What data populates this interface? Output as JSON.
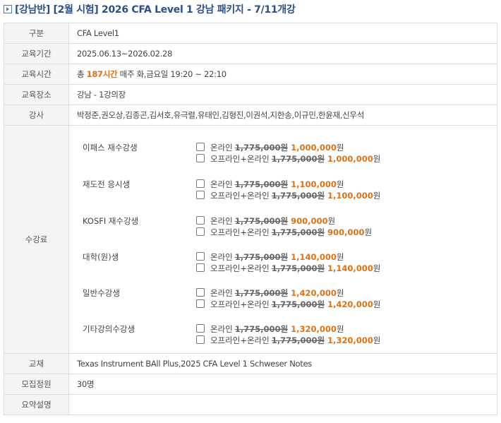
{
  "title": "[강남반] [2월 시험] 2026 CFA Level 1 강남 패키지 - 7/11개강",
  "rows": {
    "category": {
      "label": "구분",
      "value": "CFA Level1"
    },
    "period": {
      "label": "교육기간",
      "value": "2025.06.13~2026.02.28"
    },
    "hours": {
      "label": "교육시간",
      "prefix": "총 ",
      "highlight": "187시간",
      "suffix": " 매주 화,금요일 19:20 ~ 22:10"
    },
    "place": {
      "label": "교육장소",
      "value": "강남 - 1강의장"
    },
    "instructors": {
      "label": "강사",
      "value": "박정준,권오상,김종곤,김서호,유극렬,유태인,김형진,이권석,지한송,이규민,한윤재,신우석"
    },
    "fee": {
      "label": "수강료",
      "groups": [
        {
          "name": "이패스 재수강생",
          "options": [
            {
              "label": "온라인",
              "original": "1,775,000원",
              "price": "1,000,000",
              "unit": "원"
            },
            {
              "label": "오프라인+온라인",
              "original": "1,775,000원",
              "price": "1,000,000",
              "unit": "원"
            }
          ]
        },
        {
          "name": "재도전 응시생",
          "options": [
            {
              "label": "온라인",
              "original": "1,775,000원",
              "price": "1,100,000",
              "unit": "원"
            },
            {
              "label": "오프라인+온라인",
              "original": "1,775,000원",
              "price": "1,100,000",
              "unit": "원"
            }
          ]
        },
        {
          "name": "KOSFI 재수강생",
          "options": [
            {
              "label": "온라인",
              "original": "1,775,000원",
              "price": "900,000",
              "unit": "원"
            },
            {
              "label": "오프라인+온라인",
              "original": "1,775,000원",
              "price": "900,000",
              "unit": "원"
            }
          ]
        },
        {
          "name": "대학(원)생",
          "options": [
            {
              "label": "온라인",
              "original": "1,775,000원",
              "price": "1,140,000",
              "unit": "원"
            },
            {
              "label": "오프라인+온라인",
              "original": "1,775,000원",
              "price": "1,140,000",
              "unit": "원"
            }
          ]
        },
        {
          "name": "일반수강생",
          "options": [
            {
              "label": "온라인",
              "original": "1,775,000원",
              "price": "1,420,000",
              "unit": "원"
            },
            {
              "label": "오프라인+온라인",
              "original": "1,775,000원",
              "price": "1,420,000",
              "unit": "원"
            }
          ]
        },
        {
          "name": "기타강의수강생",
          "options": [
            {
              "label": "온라인",
              "original": "1,775,000원",
              "price": "1,320,000",
              "unit": "원"
            },
            {
              "label": "오프라인+온라인",
              "original": "1,775,000원",
              "price": "1,320,000",
              "unit": "원"
            }
          ]
        }
      ]
    },
    "textbook": {
      "label": "교재",
      "value": "Texas Instrument BAll Plus,2025 CFA Level 1 Schweser Notes"
    },
    "capacity": {
      "label": "모집정원",
      "value": "30명"
    },
    "summary": {
      "label": "요약설명",
      "value": ""
    }
  },
  "colors": {
    "title": "#2b4f86",
    "accent": "#e07010",
    "label_bg": "#f4f4f4",
    "border": "#dedede"
  }
}
